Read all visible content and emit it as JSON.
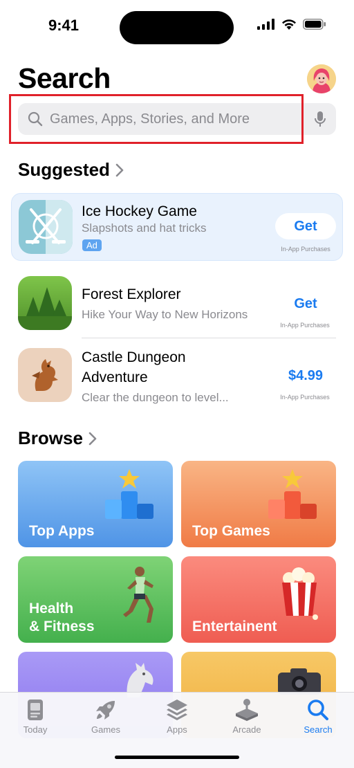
{
  "status_bar": {
    "time": "9:41"
  },
  "header": {
    "title": "Search"
  },
  "search": {
    "placeholder": "Games, Apps, Stories, and More"
  },
  "suggested": {
    "title": "Suggested",
    "apps": [
      {
        "name": "Ice Hockey Game",
        "subtitle": "Slapshots and hat tricks",
        "badge": "Ad",
        "action": "Get",
        "note": "In-App Purchases"
      },
      {
        "name": "Forest Explorer",
        "subtitle": "Hike Your Way to New Horizons",
        "action": "Get",
        "note": "In-App Purchases"
      },
      {
        "name": "Castle Dungeon Adventure",
        "subtitle": "Clear the dungeon to level...",
        "action": "$4.99",
        "note": "In-App Purchases"
      }
    ]
  },
  "browse": {
    "title": "Browse",
    "tiles": [
      {
        "label": "Top Apps",
        "color": "#5aa0ea"
      },
      {
        "label": "Top Games",
        "color": "#f4925a"
      },
      {
        "label": "Health\n& Fitness",
        "color": "#5cc162"
      },
      {
        "label": "Entertainent",
        "color": "#f2685e"
      },
      {
        "label": "",
        "color": "#8f7cf0"
      },
      {
        "label": "",
        "color": "#f2b94e"
      }
    ]
  },
  "tabbar": {
    "tabs": [
      {
        "label": "Today",
        "icon": "today-icon"
      },
      {
        "label": "Games",
        "icon": "rocket-icon"
      },
      {
        "label": "Apps",
        "icon": "layers-icon"
      },
      {
        "label": "Arcade",
        "icon": "joystick-icon"
      },
      {
        "label": "Search",
        "icon": "search-icon",
        "active": true
      }
    ]
  },
  "colors": {
    "accent": "#1a7bf0",
    "highlight": "#e0212a"
  }
}
